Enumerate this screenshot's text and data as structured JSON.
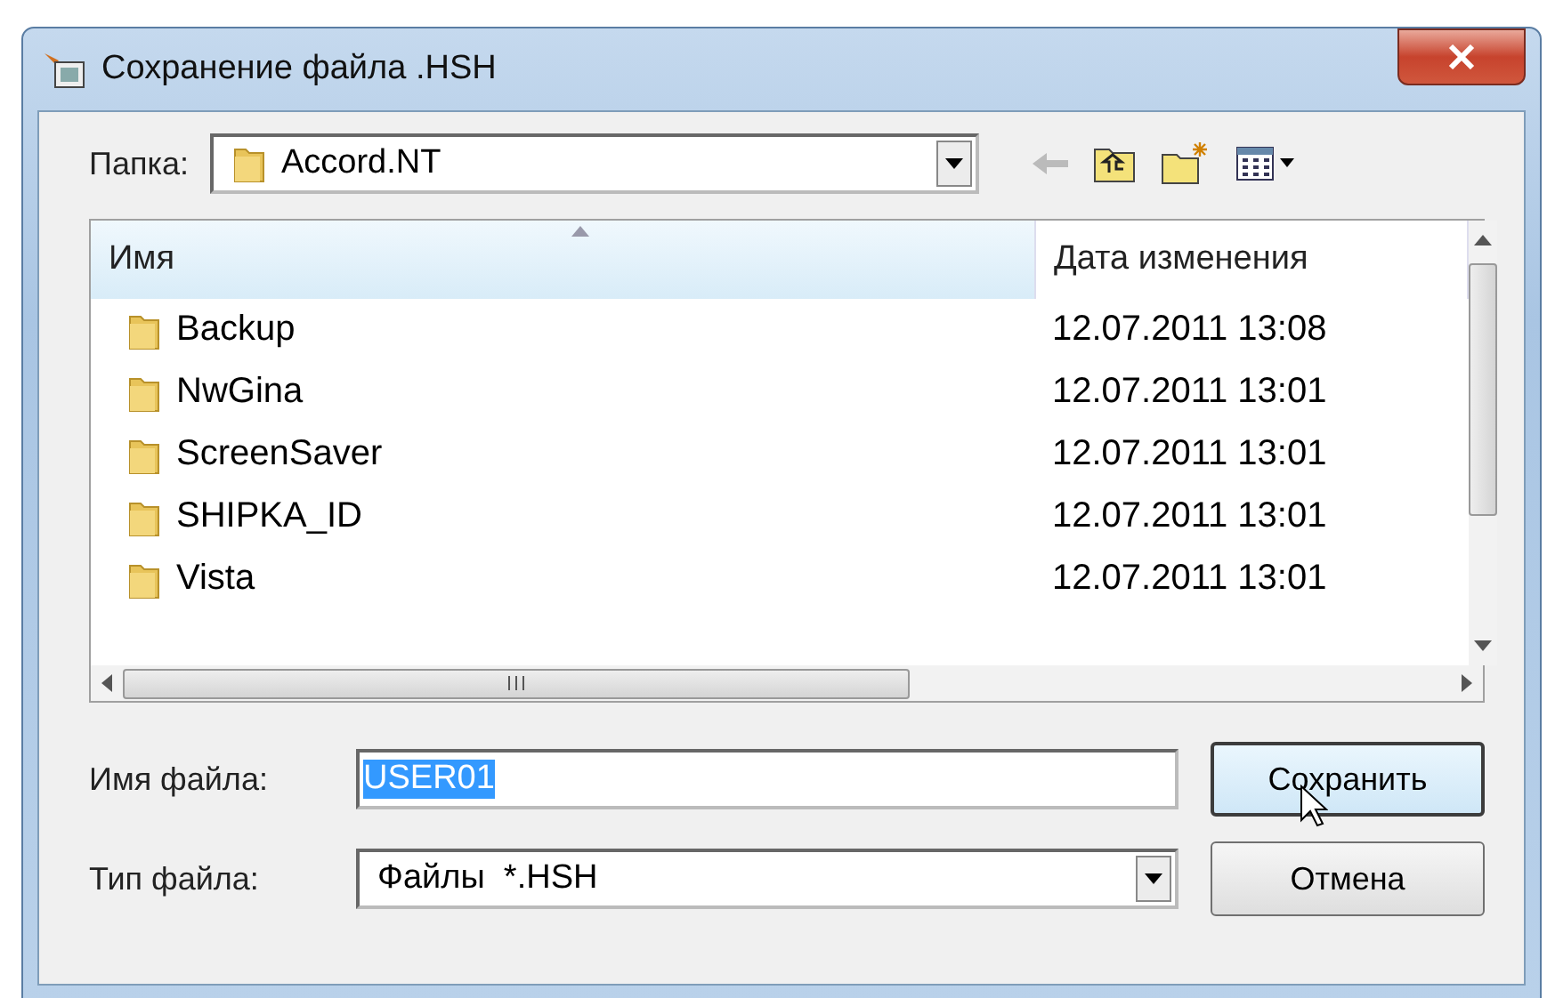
{
  "window": {
    "title": "Сохранение файла .HSH"
  },
  "folder": {
    "label": "Папка:",
    "value": "Accord.NT"
  },
  "list": {
    "columns": [
      {
        "label": "Имя",
        "sorted": true
      },
      {
        "label": "Дата изменения",
        "sorted": false
      }
    ],
    "rows": [
      {
        "name": "Backup",
        "date": "12.07.2011 13:08"
      },
      {
        "name": "NwGina",
        "date": "12.07.2011 13:01"
      },
      {
        "name": "ScreenSaver",
        "date": "12.07.2011 13:01"
      },
      {
        "name": "SHIPKA_ID",
        "date": "12.07.2011 13:01"
      },
      {
        "name": "Vista",
        "date": "12.07.2011 13:01"
      }
    ]
  },
  "file_name": {
    "label": "Имя файла:",
    "value": "USER01",
    "value_selected": true
  },
  "file_type": {
    "label": "Тип файла:",
    "value": "Файлы  *.HSH"
  },
  "buttons": [
    {
      "label": "Сохранить",
      "hovered": true
    },
    {
      "label": "Отмена",
      "hovered": false
    }
  ]
}
